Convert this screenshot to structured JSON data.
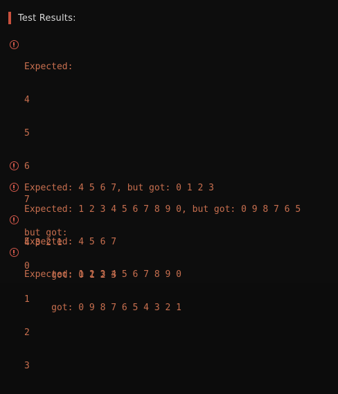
{
  "header": {
    "title": "Test Results:"
  },
  "results": [
    {
      "lines": [
        "Expected:",
        "4",
        "5",
        "6",
        "7",
        "but got:",
        "0",
        "1",
        "2",
        "3"
      ]
    },
    {
      "lines": [
        "Expected: 4 5 6 7, but got: 0 1 2 3"
      ]
    },
    {
      "lines": [
        "Expected: 1 2 3 4 5 6 7 8 9 0, but got: 0 9 8 7 6 5",
        "4 3 2 1"
      ]
    },
    {
      "lines": [
        "Expected: 4 5 6 7",
        "     got: 0 1 2 3"
      ]
    },
    {
      "lines": [
        "Expected: 1 2 3 4 5 6 7 8 9 0",
        "     got: 0 9 8 7 6 5 4 3 2 1"
      ]
    }
  ],
  "colors": {
    "background": "#0d0d0d",
    "accent": "#c9503d",
    "error_text": "#c86f4f",
    "header_text": "#d9d9d9"
  },
  "icons": {
    "result_icon": "error-circle-icon"
  }
}
